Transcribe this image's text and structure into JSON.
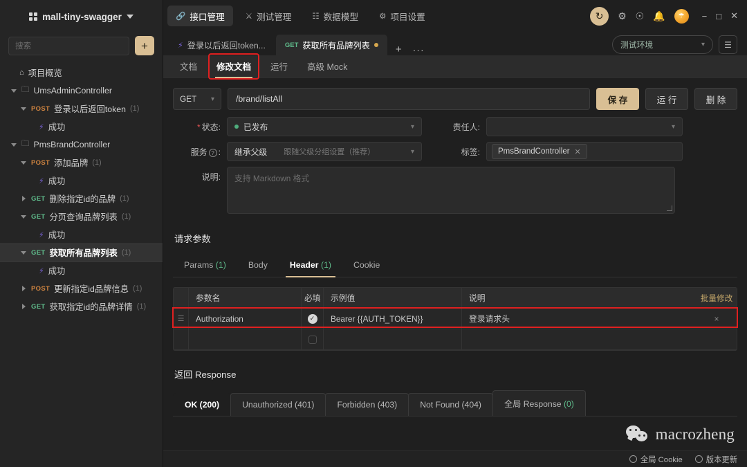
{
  "sidebar": {
    "project_name": "mall-tiny-swagger",
    "project_icon": "grid-icon",
    "search_placeholder": "搜索",
    "add_label": "+",
    "overview_label": "项目概览",
    "tree": [
      {
        "level": 0,
        "arrow": "down",
        "type": "folder",
        "label": "UmsAdminController"
      },
      {
        "level": 1,
        "arrow": "down",
        "method": "POST",
        "label": "登录以后返回token",
        "count": "(1)"
      },
      {
        "level": 2,
        "arrow": "none",
        "type": "case",
        "label": "成功"
      },
      {
        "level": 0,
        "arrow": "down",
        "type": "folder",
        "label": "PmsBrandController"
      },
      {
        "level": 1,
        "arrow": "down",
        "method": "POST",
        "label": "添加品牌",
        "count": "(1)"
      },
      {
        "level": 2,
        "arrow": "none",
        "type": "case",
        "label": "成功"
      },
      {
        "level": 1,
        "arrow": "right",
        "method": "GET",
        "label": "删除指定id的品牌",
        "count": "(1)"
      },
      {
        "level": 1,
        "arrow": "down",
        "method": "GET",
        "label": "分页查询品牌列表",
        "count": "(1)"
      },
      {
        "level": 2,
        "arrow": "none",
        "type": "case",
        "label": "成功"
      },
      {
        "level": 1,
        "arrow": "down",
        "method": "GET",
        "label": "获取所有品牌列表",
        "count": "(1)",
        "selected": true
      },
      {
        "level": 2,
        "arrow": "none",
        "type": "case",
        "label": "成功"
      },
      {
        "level": 1,
        "arrow": "right",
        "method": "POST",
        "label": "更新指定id品牌信息",
        "count": "(1)"
      },
      {
        "level": 1,
        "arrow": "right",
        "method": "GET",
        "label": "获取指定id的品牌详情",
        "count": "(1)"
      }
    ]
  },
  "topnav": {
    "items": [
      {
        "icon": "link-icon",
        "label": "接口管理",
        "active": true
      },
      {
        "icon": "flask-icon",
        "label": "测试管理",
        "active": false
      },
      {
        "icon": "model-icon",
        "label": "数据模型",
        "active": false
      },
      {
        "icon": "gear-icon",
        "label": "项目设置",
        "active": false
      }
    ],
    "right_icons": [
      "refresh-icon",
      "gear-icon",
      "help-icon",
      "bell-icon",
      "avatar"
    ],
    "window_controls": [
      "minimize",
      "maximize",
      "close"
    ]
  },
  "doctabs": {
    "tabs": [
      {
        "kind": "bolt",
        "label": "登录以后返回token...",
        "active": false,
        "dirty": false
      },
      {
        "kind": "GET",
        "label": "获取所有品牌列表",
        "active": true,
        "dirty": true
      }
    ],
    "add_label": "+",
    "more_label": "···",
    "environment": "测试环境",
    "env_list_icon": "list-icon"
  },
  "subtabs": [
    {
      "label": "文档",
      "active": false
    },
    {
      "label": "修改文档",
      "active": true,
      "highlighted": true
    },
    {
      "label": "运行",
      "active": false
    },
    {
      "label": "高级 Mock",
      "active": false
    }
  ],
  "urlbar": {
    "method": "GET",
    "path": "/brand/listAll",
    "save_label": "保 存",
    "run_label": "运 行",
    "delete_label": "删 除"
  },
  "meta": {
    "status_label": "状态:",
    "status_value": "已发布",
    "owner_label": "责任人:",
    "owner_value": "",
    "service_label": "服务",
    "service_value": "继承父级",
    "service_hint": "跟随父级分组设置（推荐）",
    "tag_label": "标签:",
    "tags": [
      "PmsBrandController"
    ],
    "desc_label": "说明:",
    "desc_placeholder": "支持 Markdown 格式"
  },
  "request": {
    "section_title": "请求参数",
    "tabs": [
      {
        "label": "Params",
        "count": "(1)",
        "active": false
      },
      {
        "label": "Body",
        "count": "",
        "active": false
      },
      {
        "label": "Header",
        "count": "(1)",
        "active": true
      },
      {
        "label": "Cookie",
        "count": "",
        "active": false
      }
    ],
    "columns": [
      "参数名",
      "必填",
      "示例值",
      "说明"
    ],
    "batch_edit": "批量修改",
    "rows": [
      {
        "name": "Authorization",
        "required": true,
        "example": "Bearer {{AUTH_TOKEN}}",
        "description": "登录请求头",
        "remove": "×",
        "highlighted": true
      },
      {
        "name": "",
        "required": false,
        "example": "",
        "description": "",
        "remove": ""
      }
    ]
  },
  "response": {
    "section_title": "返回 Response",
    "tabs": [
      {
        "label": "OK (200)",
        "active": true
      },
      {
        "label": "Unauthorized (401)",
        "active": false
      },
      {
        "label": "Forbidden (403)",
        "active": false
      },
      {
        "label": "Not Found (404)",
        "active": false
      },
      {
        "label": "全局 Response",
        "count": "(0)",
        "active": false
      }
    ]
  },
  "footer": {
    "cookie_label": "全局 Cookie",
    "version_label": "版本更新"
  },
  "watermark": {
    "text": "macrozheng",
    "icon": "wechat-icon"
  },
  "colors": {
    "accent": "#d9bf94",
    "get": "#5fbb8b",
    "post": "#d08440",
    "highlight": "#e02020",
    "published": "#4fae7d",
    "bg": "#1f1f1f",
    "sidebar_bg": "#252525"
  }
}
